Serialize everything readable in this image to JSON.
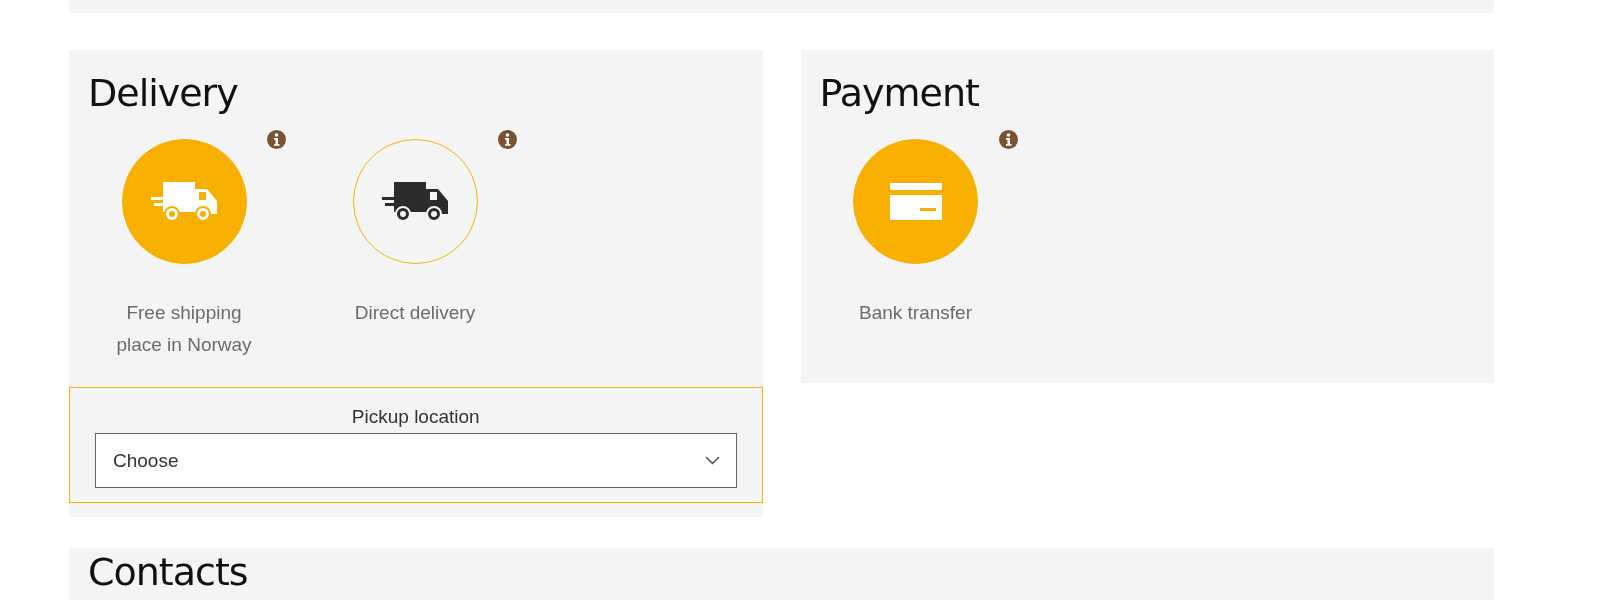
{
  "delivery": {
    "title": "Delivery",
    "options": [
      {
        "label": "Free shipping place in Norway",
        "kind": "truck",
        "selected": true
      },
      {
        "label": "Direct delivery",
        "kind": "truck",
        "selected": false
      }
    ],
    "pickup": {
      "label": "Pickup location",
      "value": "Choose"
    }
  },
  "payment": {
    "title": "Payment",
    "options": [
      {
        "label": "Bank transfer",
        "kind": "card",
        "selected": true
      }
    ]
  },
  "contacts": {
    "title": "Contacts"
  }
}
